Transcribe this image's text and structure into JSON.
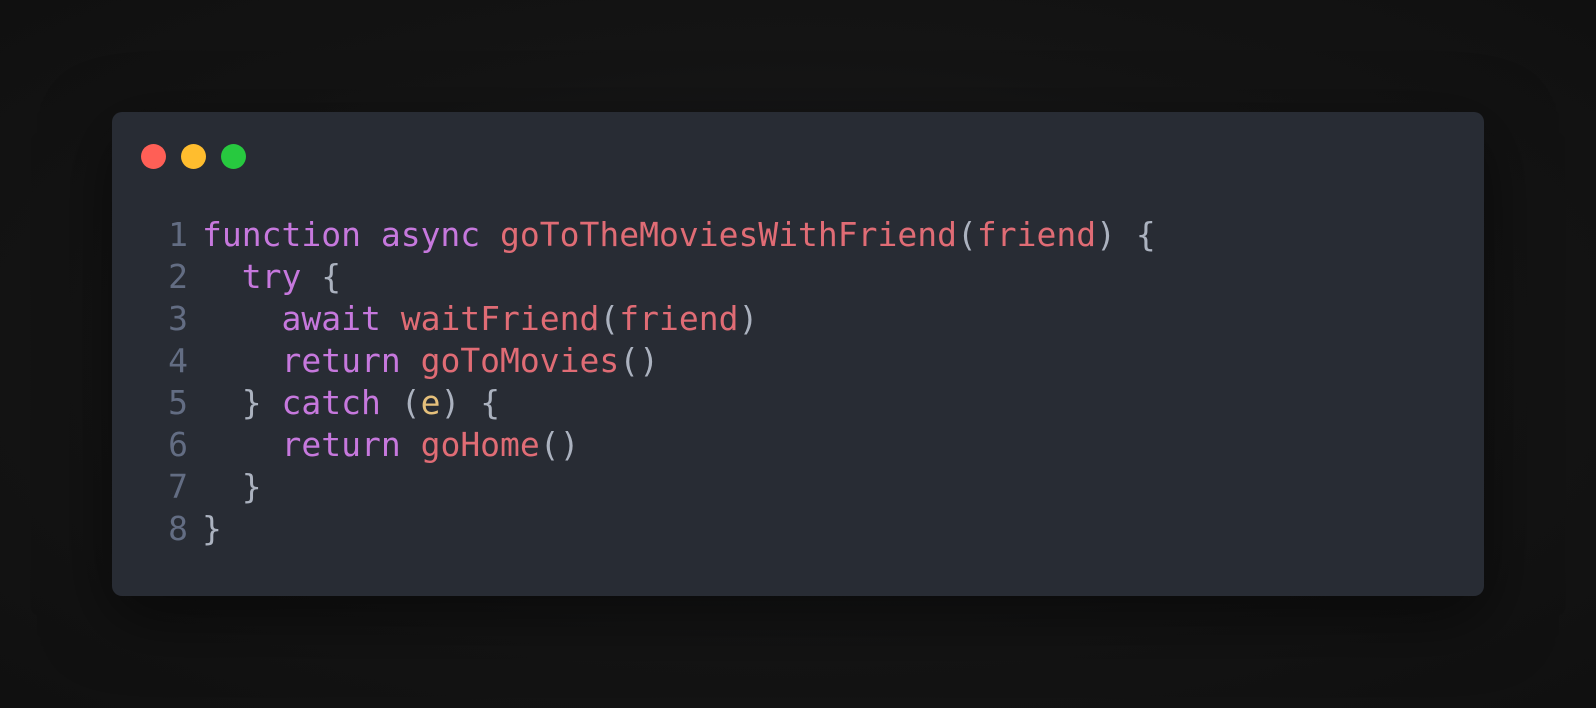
{
  "window": {
    "background": "#282c34",
    "controls": [
      {
        "name": "close",
        "color": "#ff5f56"
      },
      {
        "name": "minimize",
        "color": "#ffbd2e"
      },
      {
        "name": "maximize",
        "color": "#27c93f"
      }
    ]
  },
  "colors": {
    "keyword": "#c678dd",
    "function": "#e06c75",
    "param": "#e06c75",
    "variable": "#e5c07b",
    "punctuation": "#abb2bf",
    "line_number": "#636d83"
  },
  "code": {
    "language": "javascript",
    "lines": [
      {
        "number": "1",
        "tokens": [
          {
            "text": "function",
            "type": "keyword"
          },
          {
            "text": " ",
            "type": "punctuation"
          },
          {
            "text": "async",
            "type": "keyword"
          },
          {
            "text": " ",
            "type": "punctuation"
          },
          {
            "text": "goToTheMoviesWithFriend",
            "type": "function"
          },
          {
            "text": "(",
            "type": "punctuation"
          },
          {
            "text": "friend",
            "type": "param"
          },
          {
            "text": ") {",
            "type": "punctuation"
          }
        ]
      },
      {
        "number": "2",
        "tokens": [
          {
            "text": "  ",
            "type": "punctuation"
          },
          {
            "text": "try",
            "type": "keyword"
          },
          {
            "text": " {",
            "type": "punctuation"
          }
        ]
      },
      {
        "number": "3",
        "tokens": [
          {
            "text": "    ",
            "type": "punctuation"
          },
          {
            "text": "await",
            "type": "keyword"
          },
          {
            "text": " ",
            "type": "punctuation"
          },
          {
            "text": "waitFriend",
            "type": "function"
          },
          {
            "text": "(",
            "type": "punctuation"
          },
          {
            "text": "friend",
            "type": "param"
          },
          {
            "text": ")",
            "type": "punctuation"
          }
        ]
      },
      {
        "number": "4",
        "tokens": [
          {
            "text": "    ",
            "type": "punctuation"
          },
          {
            "text": "return",
            "type": "keyword"
          },
          {
            "text": " ",
            "type": "punctuation"
          },
          {
            "text": "goToMovies",
            "type": "function"
          },
          {
            "text": "()",
            "type": "punctuation"
          }
        ]
      },
      {
        "number": "5",
        "tokens": [
          {
            "text": "  } ",
            "type": "punctuation"
          },
          {
            "text": "catch",
            "type": "keyword"
          },
          {
            "text": " (",
            "type": "punctuation"
          },
          {
            "text": "e",
            "type": "variable"
          },
          {
            "text": ") {",
            "type": "punctuation"
          }
        ]
      },
      {
        "number": "6",
        "tokens": [
          {
            "text": "    ",
            "type": "punctuation"
          },
          {
            "text": "return",
            "type": "keyword"
          },
          {
            "text": " ",
            "type": "punctuation"
          },
          {
            "text": "goHome",
            "type": "function"
          },
          {
            "text": "()",
            "type": "punctuation"
          }
        ]
      },
      {
        "number": "7",
        "tokens": [
          {
            "text": "  }",
            "type": "punctuation"
          }
        ]
      },
      {
        "number": "8",
        "tokens": [
          {
            "text": "}",
            "type": "punctuation"
          }
        ]
      }
    ]
  }
}
